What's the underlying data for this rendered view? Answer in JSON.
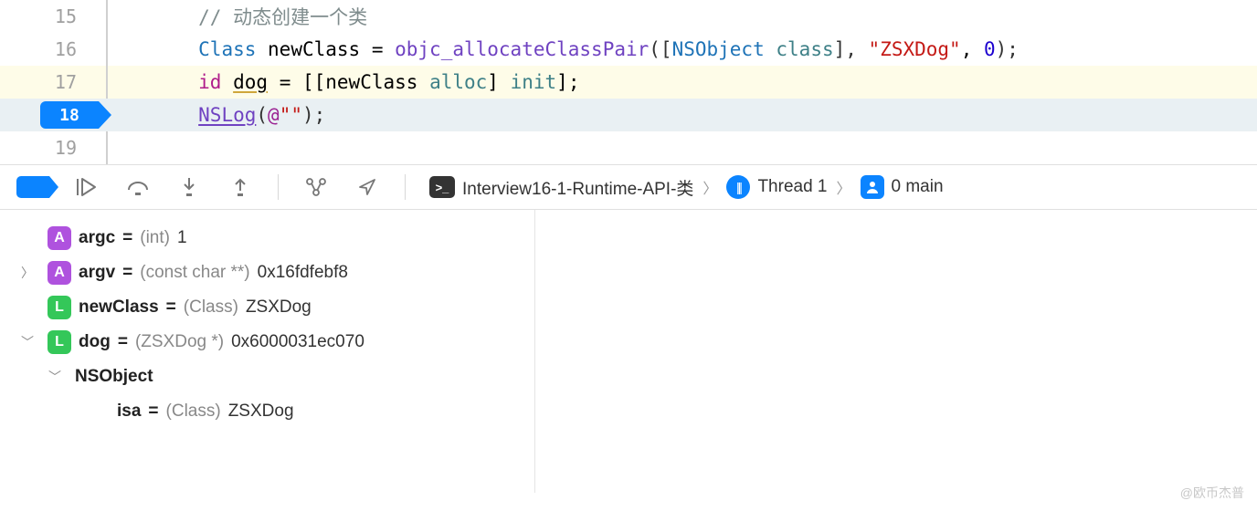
{
  "editor": {
    "lines": {
      "15": {
        "num": "15",
        "comment": "// 动态创建一个类"
      },
      "16": {
        "num": "16",
        "t_class": "Class",
        "t_var": "newClass",
        "t_eq": " = ",
        "t_fn": "objc_allocateClassPair",
        "t_lp": "([",
        "t_ns": "NSObject",
        "t_sp": " ",
        "t_msg": "class",
        "t_rp": "], ",
        "t_str": "\"ZSXDog\"",
        "t_c": ", ",
        "t_zero": "0",
        "t_end": ");"
      },
      "17": {
        "num": "17",
        "t_id": "id",
        "t_sp": " ",
        "t_var": "dog",
        "t_eq": " = [[",
        "t_nc": "newClass",
        "t_sp2": " ",
        "t_alloc": "alloc",
        "t_b": "] ",
        "t_init": "init",
        "t_end": "];"
      },
      "18": {
        "num": "18",
        "t_fn": "NSLog",
        "t_lp": "(",
        "t_at": "@",
        "t_str": "\"\"",
        "t_end": ");"
      },
      "19": {
        "num": "19"
      }
    }
  },
  "toolbar": {
    "breadcrumb": {
      "target": "Interview16-1-Runtime-API-类",
      "thread": "Thread 1",
      "frame": "0 main"
    }
  },
  "debug": {
    "vars": [
      {
        "badge": "A",
        "name": "argc",
        "eq": " = ",
        "type": "(int)",
        "val": " 1",
        "disclosure": "",
        "indent": 0
      },
      {
        "badge": "A",
        "name": "argv",
        "eq": " = ",
        "type": "(const char **)",
        "val": " 0x16fdfebf8",
        "disclosure": "▶",
        "indent": 0
      },
      {
        "badge": "L",
        "name": "newClass",
        "eq": " = ",
        "type": "(Class)",
        "val": " ZSXDog",
        "disclosure": "",
        "indent": 0
      },
      {
        "badge": "L",
        "name": "dog",
        "eq": " = ",
        "type": "(ZSXDog *)",
        "val": " 0x6000031ec070",
        "disclosure": "▼",
        "indent": 0
      },
      {
        "badge": "",
        "name": "NSObject",
        "eq": "",
        "type": "",
        "val": "",
        "disclosure": "▼",
        "indent": 1
      },
      {
        "badge": "",
        "name": "isa",
        "eq": " = ",
        "type": "(Class)",
        "val": " ZSXDog",
        "disclosure": "",
        "indent": 2
      }
    ]
  },
  "watermark": "@欧币杰普"
}
